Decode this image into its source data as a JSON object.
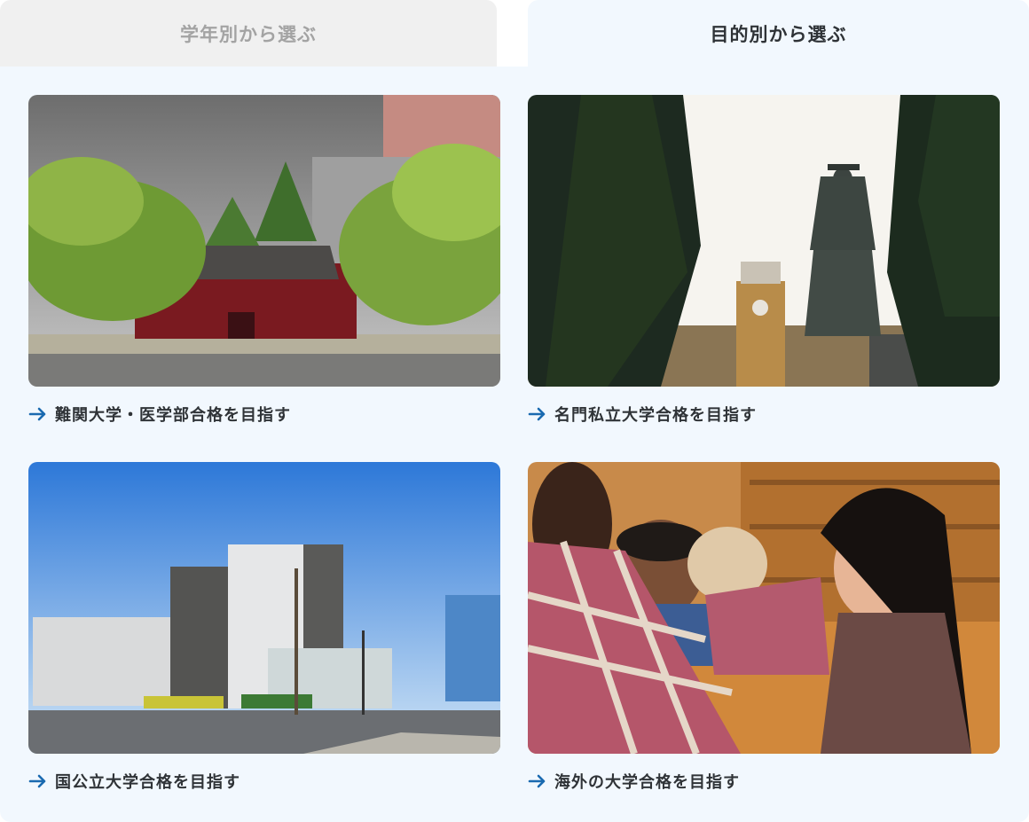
{
  "tabs": {
    "by_grade": "学年別から選ぶ",
    "by_purpose": "目的別から選ぶ"
  },
  "cards": [
    {
      "label": "難関大学・医学部合格を目指す",
      "icon": "arrow-right-icon"
    },
    {
      "label": "名門私立大学合格を目指す",
      "icon": "arrow-right-icon"
    },
    {
      "label": "国公立大学合格を目指す",
      "icon": "arrow-right-icon"
    },
    {
      "label": "海外の大学合格を目指す",
      "icon": "arrow-right-icon"
    }
  ],
  "colors": {
    "accent": "#1a6ab0",
    "panel_bg": "#f2f8fe",
    "inactive_tab_bg": "#f0f0f0",
    "inactive_tab_text": "#a3a3a3",
    "text": "#2f3337"
  }
}
